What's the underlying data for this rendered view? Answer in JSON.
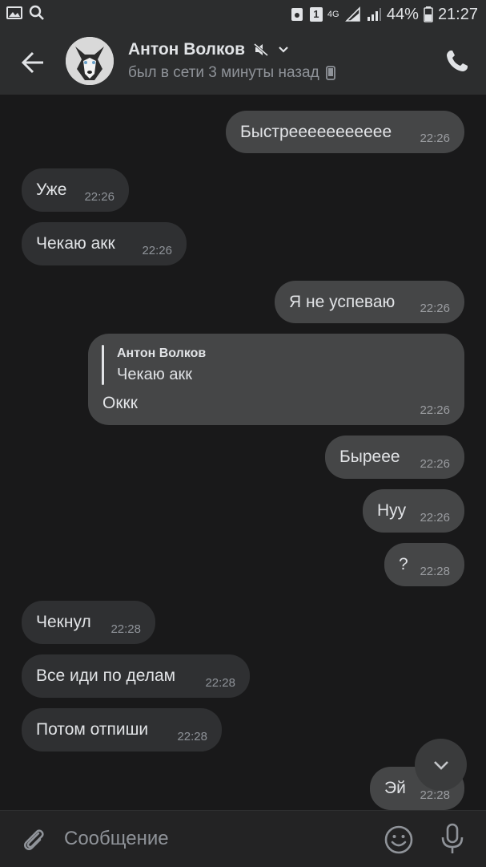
{
  "status_bar": {
    "battery": "44%",
    "time": "21:27",
    "sim": "1",
    "network": "4G"
  },
  "header": {
    "contact_name": "Антон Волков",
    "status": "был в сети 3 минуты назад"
  },
  "messages": [
    {
      "text": "Быстреееееееееее",
      "time": "22:26",
      "dir": "out"
    },
    {
      "text": "Уже",
      "time": "22:26",
      "dir": "in"
    },
    {
      "text": "Чекаю акк",
      "time": "22:26",
      "dir": "in"
    },
    {
      "text": "Я не успеваю",
      "time": "22:26",
      "dir": "out"
    },
    {
      "reply_author": "Антон Волков",
      "reply_text": "Чекаю акк",
      "text": "Оккк",
      "time": "22:26",
      "dir": "out"
    },
    {
      "text": "Быреее",
      "time": "22:26",
      "dir": "out"
    },
    {
      "text": "Нуу",
      "time": "22:26",
      "dir": "out"
    },
    {
      "text": "?",
      "time": "22:28",
      "dir": "out"
    },
    {
      "text": "Чекнул",
      "time": "22:28",
      "dir": "in"
    },
    {
      "text": "Все иди по делам",
      "time": "22:28",
      "dir": "in"
    },
    {
      "text": "Потом отпиши",
      "time": "22:28",
      "dir": "in"
    },
    {
      "text": "Эй",
      "time": "22:28",
      "dir": "out"
    }
  ],
  "composer": {
    "placeholder": "Сообщение"
  },
  "colors": {
    "background": "#19191a",
    "header": "#2c2d2e",
    "incoming_bubble": "#2f3032",
    "outgoing_bubble": "#454647"
  }
}
